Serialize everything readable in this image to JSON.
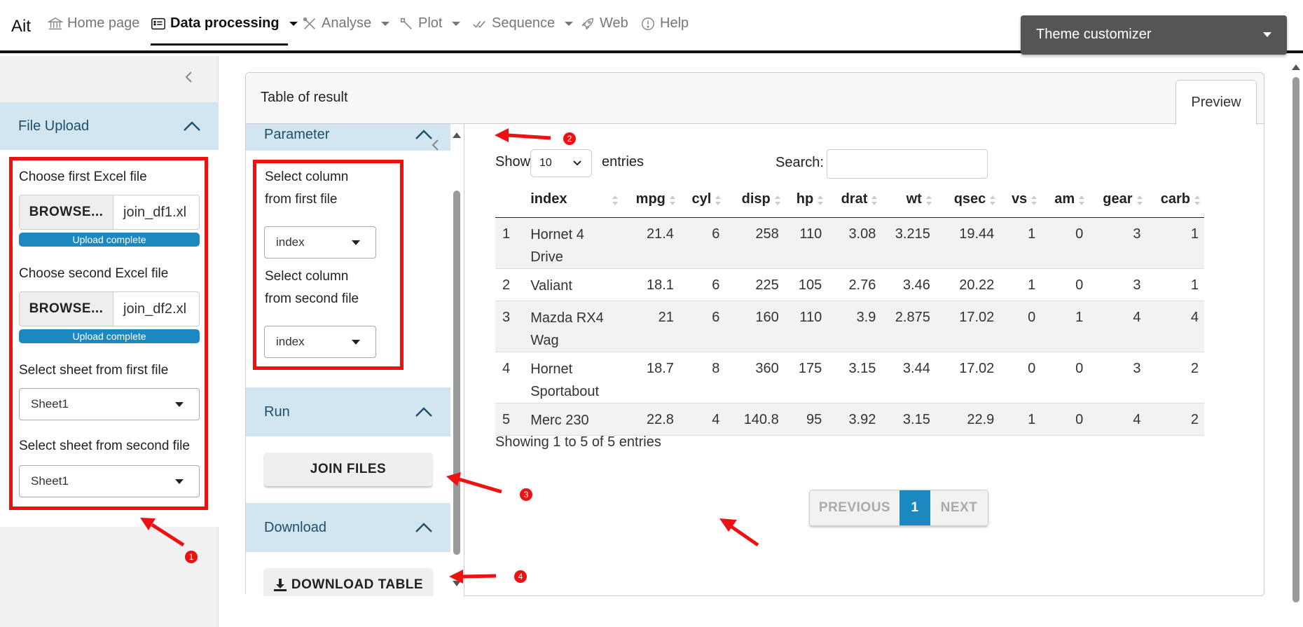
{
  "nav": {
    "brand": "Ait",
    "items": [
      {
        "label": "Home page",
        "icon": "bank-icon"
      },
      {
        "label": "Data processing",
        "icon": "card-list-icon"
      },
      {
        "label": "Analyse",
        "icon": "tools-icon"
      },
      {
        "label": "Plot",
        "icon": "wrench-icon"
      },
      {
        "label": "Sequence",
        "icon": "check-icon"
      },
      {
        "label": "Web",
        "icon": "rocket-icon"
      },
      {
        "label": "Help",
        "icon": "info-circle-icon"
      }
    ],
    "theme_customizer": "Theme customizer"
  },
  "sidebar": {
    "section_title": "File Upload",
    "first_file_label": "Choose first Excel file",
    "second_file_label": "Choose second Excel file",
    "browse_label": "BROWSE...",
    "first_file_name": "join_df1.xl",
    "second_file_name": "join_df2.xl",
    "upload_status": "Upload complete",
    "sheet_first_label": "Select sheet from first file",
    "sheet_second_label": "Select sheet from second file",
    "sheet_first_value": "Sheet1",
    "sheet_second_value": "Sheet1"
  },
  "card": {
    "title": "Table of result",
    "tab": "Preview"
  },
  "params": {
    "section_title": "Parameter",
    "col_first_label_1": "Select column",
    "col_first_label_2": "from first file",
    "col_first_value": "index",
    "col_second_label_1": "Select column",
    "col_second_label_2": "from second file",
    "col_second_value": "index",
    "run_title": "Run",
    "join_button": "JOIN FILES",
    "download_title": "Download",
    "download_button": "DOWNLOAD TABLE"
  },
  "table": {
    "show_label": "Show",
    "entries_value": "10",
    "entries_label": "entries",
    "search_label": "Search:",
    "columns": [
      "index",
      "mpg",
      "cyl",
      "disp",
      "hp",
      "drat",
      "wt",
      "qsec",
      "vs",
      "am",
      "gear",
      "carb"
    ],
    "rows": [
      {
        "n": "1",
        "name1": "Hornet 4",
        "name2": "Drive",
        "vals": [
          "21.4",
          "6",
          "258",
          "110",
          "3.08",
          "3.215",
          "19.44",
          "1",
          "0",
          "3",
          "1"
        ]
      },
      {
        "n": "2",
        "name1": "Valiant",
        "name2": "",
        "vals": [
          "18.1",
          "6",
          "225",
          "105",
          "2.76",
          "3.46",
          "20.22",
          "1",
          "0",
          "3",
          "1"
        ]
      },
      {
        "n": "3",
        "name1": "Mazda RX4",
        "name2": "Wag",
        "vals": [
          "21",
          "6",
          "160",
          "110",
          "3.9",
          "2.875",
          "17.02",
          "0",
          "1",
          "4",
          "4"
        ]
      },
      {
        "n": "4",
        "name1": "Hornet",
        "name2": "Sportabout",
        "vals": [
          "18.7",
          "8",
          "360",
          "175",
          "3.15",
          "3.44",
          "17.02",
          "0",
          "0",
          "3",
          "2"
        ]
      },
      {
        "n": "5",
        "name1": "Merc 230",
        "name2": "",
        "vals": [
          "22.8",
          "4",
          "140.8",
          "95",
          "3.92",
          "3.15",
          "22.9",
          "1",
          "0",
          "4",
          "2"
        ]
      }
    ],
    "info": "Showing 1 to 5 of 5 entries",
    "prev": "PREVIOUS",
    "page": "1",
    "next": "NEXT"
  },
  "annotations": [
    "1",
    "2",
    "3",
    "4"
  ],
  "colors": {
    "accent_blue": "#1b88bf",
    "accordion_bg": "#d1e6f0",
    "annotation_red": "#ee1111"
  }
}
